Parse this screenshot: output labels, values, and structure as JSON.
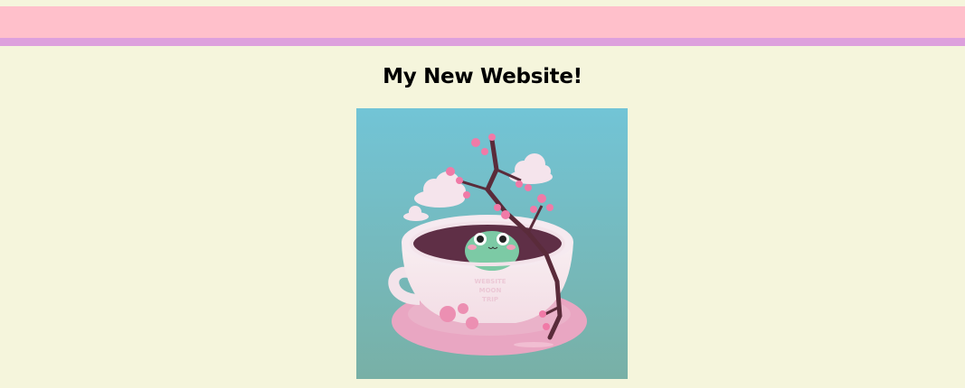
{
  "page": {
    "title": "My New Website!"
  },
  "header": {
    "bar_color": "#ffc0cb",
    "accent_color": "#dda0dd"
  },
  "background_color": "#f5f5dc",
  "hero_image": {
    "alt": "Frog in a pink teacup with cherry blossom branch",
    "cup_text": [
      "WEBSITE",
      "MOON",
      "TRIP"
    ]
  }
}
